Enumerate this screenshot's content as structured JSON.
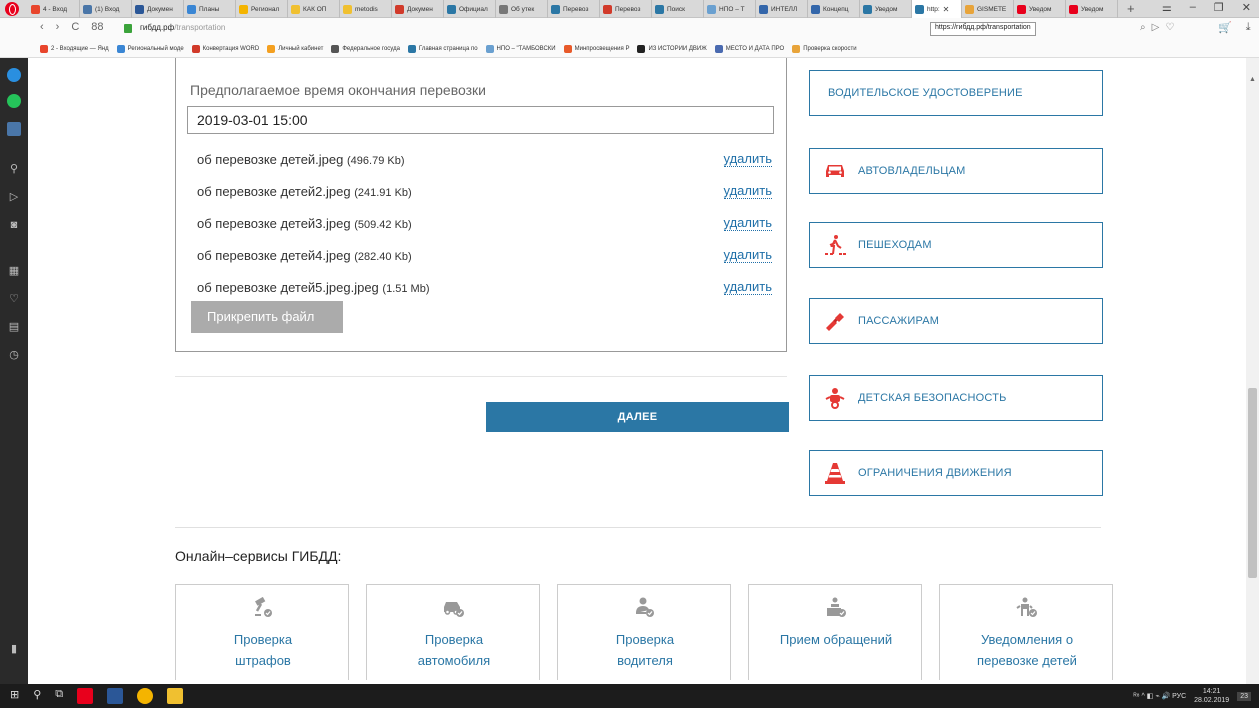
{
  "browser": {
    "tabs": [
      {
        "label": "4 - Вход",
        "color": "#e8452c"
      },
      {
        "label": "(1) Вход",
        "color": "#4a76a8"
      },
      {
        "label": "Докумен",
        "color": "#2b5797"
      },
      {
        "label": "Планы",
        "color": "#3a86d4"
      },
      {
        "label": "Регионал",
        "color": "#f4b400"
      },
      {
        "label": "КАК ОП",
        "color": "#f0c030"
      },
      {
        "label": "metodis",
        "color": "#f0c030"
      },
      {
        "label": "Докумен",
        "color": "#d13a2a"
      },
      {
        "label": "Официал",
        "color": "#2b77a5"
      },
      {
        "label": "Об утек",
        "color": "#777777"
      },
      {
        "label": "Перевоз",
        "color": "#2b77a5"
      },
      {
        "label": "Перевоз",
        "color": "#d13a2a"
      },
      {
        "label": "Поиск",
        "color": "#2b77a5"
      },
      {
        "label": "НПО – Т",
        "color": "#6aa0d0"
      },
      {
        "label": "ИНТЕЛЛ",
        "color": "#3366aa"
      },
      {
        "label": "Концепц",
        "color": "#3366aa"
      },
      {
        "label": "Уведом",
        "color": "#2b77a5"
      },
      {
        "label": "http:",
        "color": "#2b77a5",
        "active": true
      },
      {
        "label": "GISMETE",
        "color": "#e8a43a"
      },
      {
        "label": "Уведом",
        "color": "#e8001c"
      },
      {
        "label": "Уведом",
        "color": "#e8001c"
      }
    ],
    "tab_close": "✕",
    "tab_plus": "+",
    "window_controls": [
      "⚌",
      "–",
      "❐",
      "✕"
    ],
    "nav": [
      "‹",
      "›",
      "C",
      "88"
    ],
    "url_host": "гибдд.рф",
    "url_path": "/transportation",
    "url_tooltip": "https://гибдд.рф/transportation",
    "addr_icons": [
      "⌕",
      "▷",
      "♡"
    ],
    "addr_right": [
      "🛒",
      "⤓"
    ],
    "bookmarks": [
      {
        "label": "2 - Входящие — Янд",
        "color": "#e8452c"
      },
      {
        "label": "Региональный моде",
        "color": "#3a86d4"
      },
      {
        "label": "Конвертация WORD",
        "color": "#d13a2a"
      },
      {
        "label": "Личный кабинет",
        "color": "#f4a020"
      },
      {
        "label": "Федеральное госуда",
        "color": "#555555"
      },
      {
        "label": "Главная страница по",
        "color": "#2b77a5"
      },
      {
        "label": "НПО – \"ТАМБОВСКИ",
        "color": "#6aa0d0"
      },
      {
        "label": "Минпросвещения Р",
        "color": "#e85a2a"
      },
      {
        "label": "ИЗ ИСТОРИИ ДВИЖ",
        "color": "#222222"
      },
      {
        "label": "МЕСТО И ДАТА ПРО",
        "color": "#4a6ab0"
      },
      {
        "label": "Проверка скорости",
        "color": "#e8a43a"
      }
    ]
  },
  "form": {
    "end_label": "Предполагаемое время окончания перевозки",
    "end_value": "2019-03-01 15:00",
    "files": [
      {
        "name": "об перевозке детей.jpeg",
        "size": "(496.79 Kb)",
        "delete": "удалить"
      },
      {
        "name": "об перевозке детей2.jpeg",
        "size": "(241.91 Kb)",
        "delete": "удалить"
      },
      {
        "name": "об перевозке детей3.jpeg",
        "size": "(509.42 Kb)",
        "delete": "удалить"
      },
      {
        "name": "об перевозке детей4.jpeg",
        "size": "(282.40 Kb)",
        "delete": "удалить"
      },
      {
        "name": "об перевозке детей5.jpeg.jpeg",
        "size": "(1.51 Mb)",
        "delete": "удалить"
      }
    ],
    "attach_label": "Прикрепить файл",
    "next_label": "ДАЛЕЕ"
  },
  "categories": [
    {
      "label": "ВОДИТЕЛЬСКОЕ УДОСТОВЕРЕНИЕ",
      "icon": "none"
    },
    {
      "label": "АВТОВЛАДЕЛЬЦАМ",
      "icon": "car-icon"
    },
    {
      "label": "ПЕШЕХОДАМ",
      "icon": "pedestrian-icon"
    },
    {
      "label": "ПАССАЖИРАМ",
      "icon": "seatbelt-icon"
    },
    {
      "label": "ДЕТСКАЯ БЕЗОПАСНОСТЬ",
      "icon": "child-icon"
    },
    {
      "label": "ОГРАНИЧЕНИЯ ДВИЖЕНИЯ",
      "icon": "traffic-cone-icon"
    }
  ],
  "services": {
    "title": "Онлайн–сервисы ГИБДД:",
    "items": [
      {
        "line1": "Проверка",
        "line2": "штрафов",
        "icon": "fines-check-icon"
      },
      {
        "line1": "Проверка",
        "line2": "автомобиля",
        "icon": "car-check-icon"
      },
      {
        "line1": "Проверка",
        "line2": "водителя",
        "icon": "driver-check-icon"
      },
      {
        "line1": "Прием обращений",
        "line2": "",
        "icon": "appeal-icon"
      },
      {
        "line1": "Уведомления о",
        "line2": "перевозке детей",
        "icon": "child-transport-icon"
      }
    ]
  },
  "taskbar": {
    "left": [
      "⊞",
      "⚲",
      "⧉"
    ],
    "tray": "ᴿ⁸  ^  ◧  ⌁  🔊  РУС",
    "time": "14:21",
    "date": "28.02.2019",
    "notif": "23"
  },
  "colors": {
    "accent": "#2b77a5",
    "red": "#e53935"
  }
}
